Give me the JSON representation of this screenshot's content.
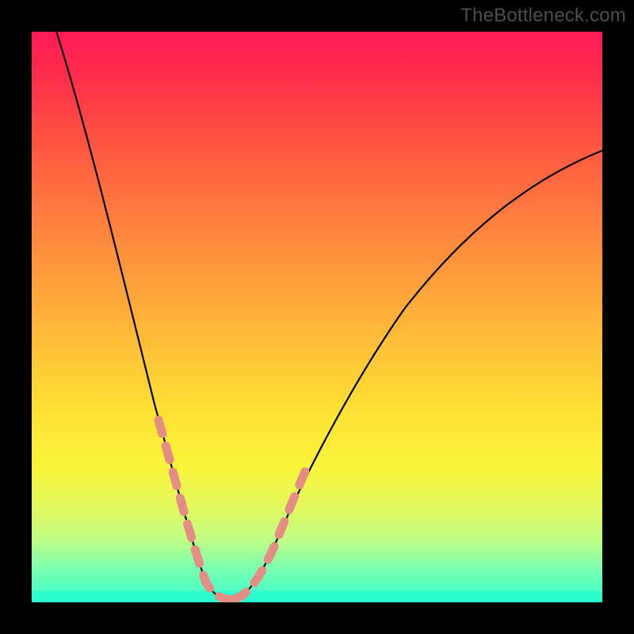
{
  "watermark": "TheBottleneck.com",
  "colors": {
    "background": "#000000",
    "watermark_text": "#4e4e4e",
    "curve_stroke": "#000000",
    "dot_stroke": "#e38d85",
    "gradient_top": "#ff1a57",
    "gradient_bottom": "#37ffce"
  },
  "chart_data": {
    "type": "line",
    "title": "",
    "xlabel": "",
    "ylabel": "",
    "x": [
      0.03,
      0.06,
      0.09,
      0.12,
      0.15,
      0.18,
      0.21,
      0.24,
      0.27,
      0.3,
      0.33,
      0.36,
      0.4,
      0.5,
      0.6,
      0.7,
      0.8,
      0.9,
      1.0
    ],
    "values": [
      100,
      90,
      80,
      70,
      58,
      46,
      34,
      22,
      12,
      4,
      0,
      2,
      8,
      22,
      38,
      52,
      62,
      70,
      76
    ],
    "xlim": [
      0,
      1
    ],
    "ylim": [
      0,
      100
    ],
    "annotations": {
      "highlight_x_range": [
        0.22,
        0.42
      ],
      "highlight_style": "salmon dotted overlay on lower V of curve"
    }
  }
}
